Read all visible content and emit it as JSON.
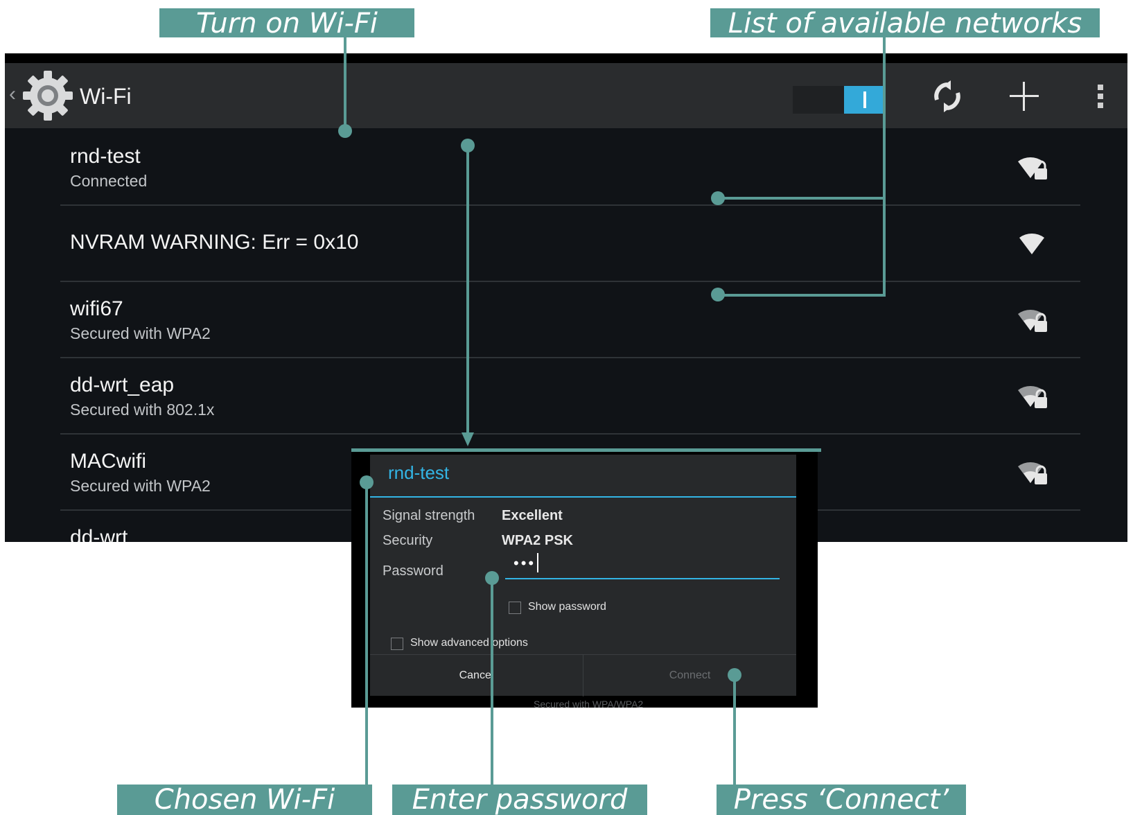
{
  "actionbar": {
    "title": "Wi-Fi",
    "wifi_toggle_state": "on",
    "icons": [
      "back-icon",
      "settings-gear-icon",
      "scan-refresh-icon",
      "add-network-icon",
      "overflow-menu-icon"
    ]
  },
  "networks": [
    {
      "name": "rnd-test",
      "status": "Connected",
      "icon": "wifi-signal-locked-icon"
    },
    {
      "name": "NVRAM WARNING: Err = 0x10",
      "status": "",
      "icon": "wifi-signal-icon"
    },
    {
      "name": "wifi67",
      "status": "Secured with WPA2",
      "icon": "wifi-signal-locked-icon"
    },
    {
      "name": "dd-wrt_eap",
      "status": "Secured with 802.1x",
      "icon": "wifi-signal-locked-icon"
    },
    {
      "name": "MACwifi",
      "status": "Secured with WPA2",
      "icon": "wifi-signal-locked-icon"
    },
    {
      "name": "dd-wrt",
      "status": "",
      "icon": "wifi-signal-locked-icon"
    }
  ],
  "dialog": {
    "title": "rnd-test",
    "signal_label": "Signal strength",
    "signal_value": "Excellent",
    "security_label": "Security",
    "security_value": "WPA2 PSK",
    "password_label": "Password",
    "password_value": "•••",
    "show_password_label": "Show password",
    "show_advanced_label": "Show advanced options",
    "cancel_label": "Cancel",
    "connect_label": "Connect",
    "behind_text": "Secured with WPA/WPA2"
  },
  "annotations": {
    "turn_on_wifi": "Turn on Wi-Fi",
    "list_networks": "List of available networks",
    "chosen_wifi": "Chosen Wi-Fi",
    "enter_password": "Enter password",
    "press_connect": "Press ‘Connect’"
  },
  "colors": {
    "accent": "#33b5e5",
    "callout": "#5a9b95",
    "screen_bg": "#101317",
    "actionbar_bg": "#2a2c2e"
  }
}
